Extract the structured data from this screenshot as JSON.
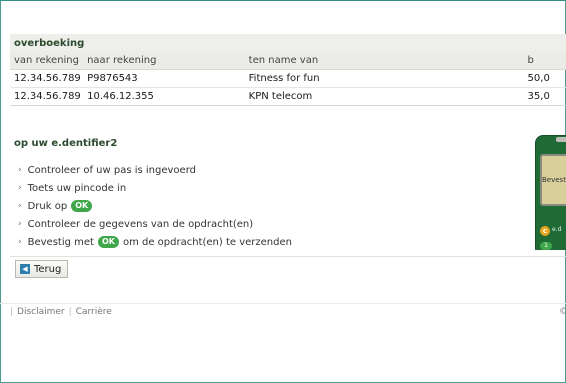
{
  "transfer": {
    "title": "overboeking",
    "columns": {
      "from": "van rekening",
      "to": "naar rekening",
      "name": "ten name van",
      "amount": "b"
    },
    "rows": [
      {
        "from": "12.34.56.789",
        "to": "P9876543",
        "name": "Fitness for fun",
        "amount": "50,0"
      },
      {
        "from": "12.34.56.789",
        "to": "10.46.12.355",
        "name": "KPN telecom",
        "amount": "35,0"
      }
    ]
  },
  "identifier": {
    "title": "op uw e.dentifier2",
    "steps": [
      {
        "text": "Controleer of uw pas is ingevoerd"
      },
      {
        "text": "Toets uw pincode in"
      },
      {
        "prefix": "Druk op",
        "badge": "OK"
      },
      {
        "text": "Controleer de gegevens van de opdracht(en)"
      },
      {
        "prefix": "Bevestig met",
        "badge": "OK",
        "suffix": "om de opdracht(en) te verzenden"
      }
    ],
    "device": {
      "screen_text": "Bevest",
      "button_c": "c",
      "button_c_label": "e.d",
      "button_1": "1"
    }
  },
  "back_button": {
    "label": "Terug"
  },
  "footer": {
    "links": [
      "Disclaimer",
      "Carrière"
    ],
    "copyright": "©"
  },
  "colors": {
    "title_green": "#2c4a2e",
    "ok_green": "#3fa64a",
    "header_bg": "#ebebe7",
    "frame_border": "#4d9b8e"
  }
}
